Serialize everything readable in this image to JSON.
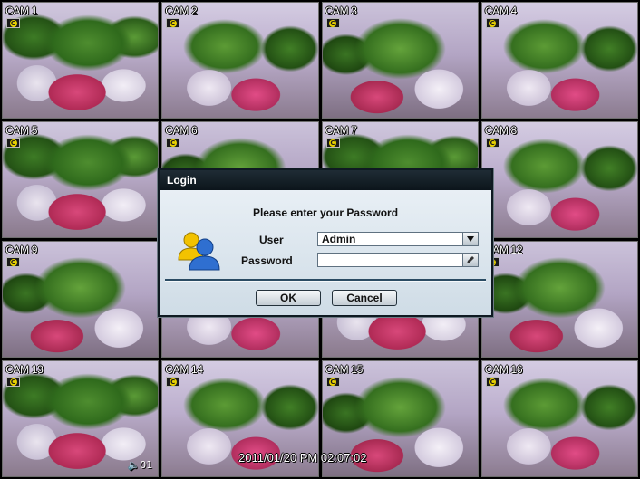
{
  "cameras": [
    {
      "label": "CAM 1"
    },
    {
      "label": "CAM 2"
    },
    {
      "label": "CAM 3"
    },
    {
      "label": "CAM 4"
    },
    {
      "label": "CAM 5"
    },
    {
      "label": "CAM 6"
    },
    {
      "label": "CAM 7"
    },
    {
      "label": "CAM 8"
    },
    {
      "label": "CAM 9"
    },
    {
      "label": ""
    },
    {
      "label": ""
    },
    {
      "label": "CAM 12"
    },
    {
      "label": "CAM 13"
    },
    {
      "label": "CAM 14"
    },
    {
      "label": "CAM 15"
    },
    {
      "label": "CAM 16"
    }
  ],
  "status": {
    "timestamp": "2011/01/20 PM 02:07:02",
    "rec_icon": "C",
    "audio_label": "01"
  },
  "login": {
    "title": "Login",
    "prompt": "Please enter your Password",
    "user_label": "User",
    "user_value": "Admin",
    "password_label": "Password",
    "password_value": "",
    "ok_label": "OK",
    "cancel_label": "Cancel"
  },
  "icons": {
    "users": "users-icon",
    "dropdown": "chevron-down-icon",
    "keyboard": "pencil-icon",
    "recording": "recording-icon",
    "audio": "speaker-icon"
  },
  "colors": {
    "dialog_title_bg": "#0c151b",
    "dialog_bg": "#d6e1ea",
    "rec_badge": "#e8d200"
  }
}
